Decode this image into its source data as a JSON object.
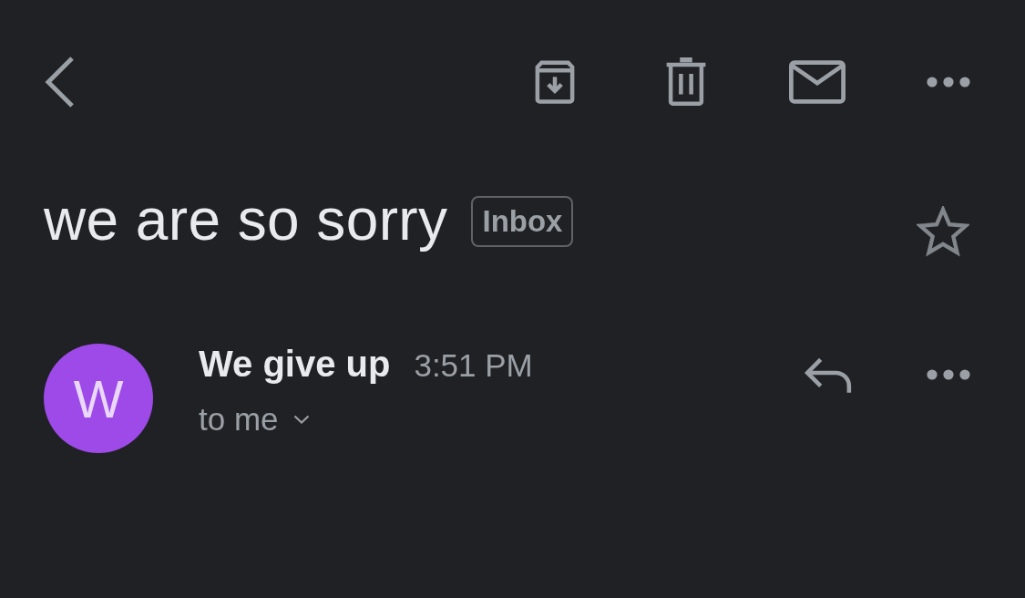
{
  "subject": {
    "text": "we are so sorry",
    "label": "Inbox",
    "starred": false
  },
  "message": {
    "avatar_letter": "W",
    "sender": "We give up",
    "time": "3:51 PM",
    "recipient": "to me"
  }
}
